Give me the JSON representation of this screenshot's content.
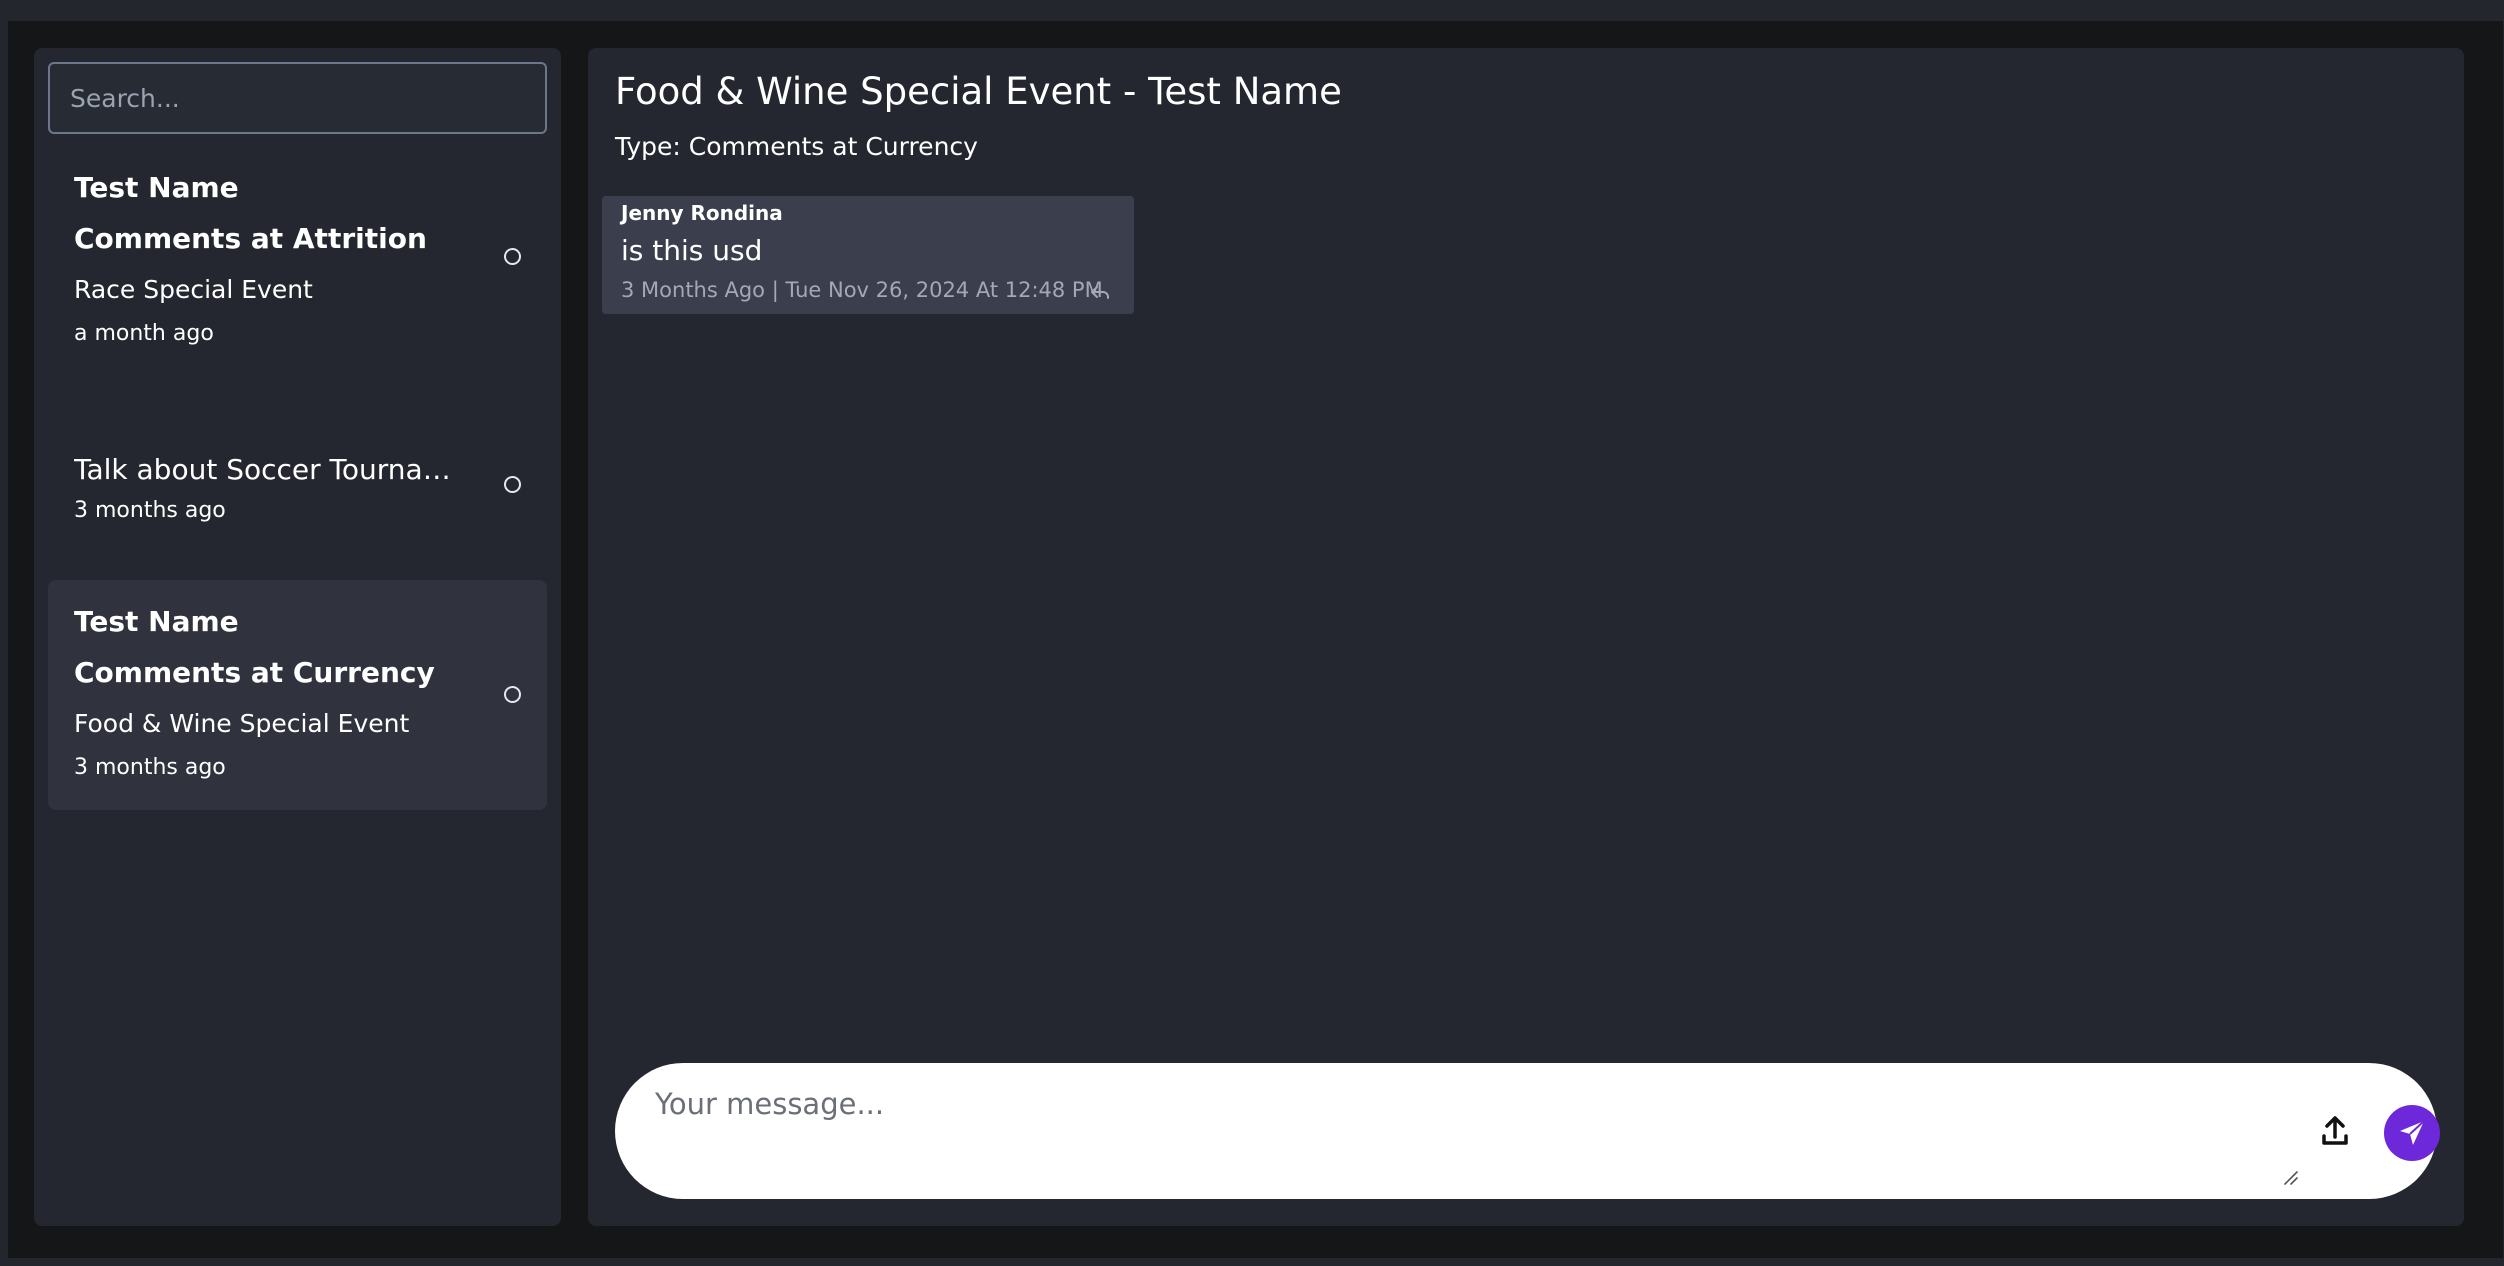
{
  "search": {
    "placeholder": "Search..."
  },
  "threads": [
    {
      "name": "Test Name",
      "type": "Comments at Attrition",
      "event": "Race Special Event",
      "time": "a month ago",
      "selected": false
    },
    {
      "title": "Talk about Soccer Tournam...",
      "time": "3 months ago",
      "selected": false
    },
    {
      "name": "Test Name",
      "type": "Comments at Currency",
      "event": "Food & Wine Special Event",
      "time": "3 months ago",
      "selected": true
    }
  ],
  "conversation": {
    "title": "Food & Wine Special Event - Test Name",
    "type_line": "Type: Comments at Currency",
    "messages": [
      {
        "author": "Jenny Rondina",
        "text": "is this usd",
        "meta": "3 Months Ago | Tue Nov 26, 2024 At 12:48 PM"
      }
    ]
  },
  "composer": {
    "placeholder": "Your message...",
    "accent": "#6d28d9"
  },
  "colors": {
    "page_bg": "#23262d",
    "frame_bg": "#151618",
    "panel_bg": "#24272f",
    "selected_bg": "#30333d",
    "message_bg": "#3b3f4d"
  }
}
